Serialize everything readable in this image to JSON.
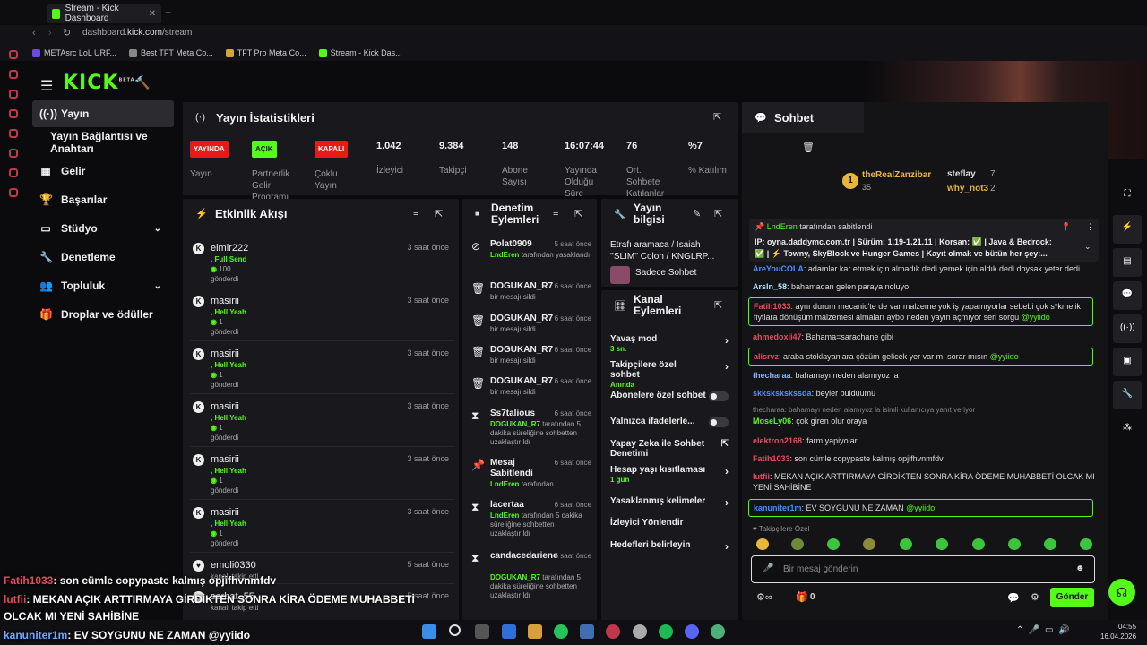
{
  "browser": {
    "tab_title": "Stream - Kick Dashboard",
    "url_prefix": "dashboard.",
    "url_domain": "kick.com",
    "url_path": "/stream",
    "bookmarks": [
      "METAsrc LoL URF...",
      "Best TFT Meta Co...",
      "TFT Pro Meta Co...",
      "Stream - Kick Das..."
    ]
  },
  "header": {
    "logo": "KICK",
    "logo_sup": "BETA"
  },
  "sidebar": {
    "items": [
      {
        "label": "Yayın",
        "icon": "broadcast-icon"
      },
      {
        "label": "Yayın Bağlantısı ve Anahtarı"
      },
      {
        "label": "Gelir",
        "icon": "revenue-icon"
      },
      {
        "label": "Başarılar",
        "icon": "trophy-icon"
      },
      {
        "label": "Stüdyo",
        "icon": "studio-icon"
      },
      {
        "label": "Denetleme",
        "icon": "wrench-icon"
      },
      {
        "label": "Topluluk",
        "icon": "community-icon"
      },
      {
        "label": "Droplar ve ödüller",
        "icon": "gift-icon"
      }
    ]
  },
  "stats": {
    "title": "Yayın İstatistikleri",
    "items": [
      {
        "value": "YAYINDA",
        "label": "Yayın",
        "badge_color": "#e91916"
      },
      {
        "value": "AÇIK",
        "label": "Partnerlik Gelir Programı",
        "badge_color": "#53fc18"
      },
      {
        "value": "KAPALI",
        "label": "Çoklu Yayın",
        "badge_color": "#e91916"
      },
      {
        "value": "1.042",
        "label": "İzleyici"
      },
      {
        "value": "9.384",
        "label": "Takipçi"
      },
      {
        "value": "148",
        "label": "Abone Sayısı"
      },
      {
        "value": "16:07:44",
        "label": "Yayında Olduğu Süre"
      },
      {
        "value": "76",
        "label": "Ort. Sohbete Katılanlar"
      },
      {
        "value": "%7",
        "label": "% Katılım"
      }
    ]
  },
  "activity": {
    "title": "Etkinlik Akışı",
    "items": [
      {
        "user": "elmir222",
        "time": "3 saat önce",
        "line1": ", Full Send",
        "amount": "100",
        "line3": "gönderdi"
      },
      {
        "user": "masirii",
        "time": "3 saat önce",
        "line1": ", Hell Yeah",
        "amount": "1",
        "line3": "gönderdi"
      },
      {
        "user": "masirii",
        "time": "3 saat önce",
        "line1": ", Hell Yeah",
        "amount": "1",
        "line3": "gönderdi"
      },
      {
        "user": "masirii",
        "time": "3 saat önce",
        "line1": ", Hell Yeah",
        "amount": "1",
        "line3": "gönderdi"
      },
      {
        "user": "masirii",
        "time": "3 saat önce",
        "line1": ", Hell Yeah",
        "amount": "1",
        "line3": "gönderdi"
      },
      {
        "user": "masirii",
        "time": "3 saat önce",
        "line1": ", Hell Yeah",
        "amount": "1",
        "line3": "gönderdi"
      },
      {
        "user": "emoli0330",
        "time": "5 saat önce",
        "line1": "kanalı takip etti",
        "amount": "",
        "line3": ""
      },
      {
        "user": "serbat_55",
        "time": "5 saat önce",
        "line1": "kanalı takip etti",
        "amount": "",
        "line3": ""
      }
    ]
  },
  "moderation": {
    "title": "Denetim Eylemleri",
    "items": [
      {
        "user": "Polat0909",
        "time": "5 saat önce",
        "by": "LndEren",
        "text": "tarafından yasaklandı"
      },
      {
        "user": "DOGUKAN_R7",
        "time": "6 saat önce",
        "by": "",
        "text": "bir mesajı sildi"
      },
      {
        "user": "DOGUKAN_R7",
        "time": "6 saat önce",
        "by": "",
        "text": "bir mesajı sildi"
      },
      {
        "user": "DOGUKAN_R7",
        "time": "6 saat önce",
        "by": "",
        "text": "bir mesajı sildi"
      },
      {
        "user": "DOGUKAN_R7",
        "time": "6 saat önce",
        "by": "",
        "text": "bir mesajı sildi"
      },
      {
        "user": "Ss7talious",
        "time": "6 saat önce",
        "by": "DOGUKAN_R7",
        "text": "tarafından 5 dakika süreliğine sohbetten uzaklaştırıldı"
      },
      {
        "user": "Mesaj Sabitlendi",
        "time": "6 saat önce",
        "by": "LndEren",
        "text": "tarafından"
      },
      {
        "user": "lacertaa",
        "time": "6 saat önce",
        "by": "LndEren",
        "text": "tarafından 5 dakika süreliğine sohbetten uzaklaştırıldı"
      },
      {
        "user": "candacedariene",
        "time": "6 saat önce",
        "by": "DOGUKAN_R7",
        "text": "tarafından 5 dakika süreliğine sohbetten uzaklaştırıldı"
      }
    ]
  },
  "stream_info": {
    "title": "Yayın bilgisi",
    "stream_title": "Etrafı aramaca / Isaiah ''SLIM'' Colon / KNGLRP...",
    "category": "Sadece Sohbet"
  },
  "channel_actions": {
    "title": "Kanal Eylemleri",
    "items": [
      {
        "label": "Yavaş mod",
        "sub": "3 sn.",
        "control": "arrow"
      },
      {
        "label": "Takipçilere özel sohbet",
        "sub": "Anında",
        "control": "arrow"
      },
      {
        "label": "Abonelere özel sohbet",
        "sub": "",
        "control": "toggle"
      },
      {
        "label": "Yalnızca ifadelerle...",
        "sub": "",
        "control": "toggle"
      },
      {
        "label": "Yapay Zeka ile Sohbet Denetimi",
        "sub": "",
        "control": "external"
      },
      {
        "label": "Hesap yaşı kısıtlaması",
        "sub": "1 gün",
        "control": "arrow"
      },
      {
        "label": "Yasaklanmış kelimeler",
        "sub": "",
        "control": "arrow"
      },
      {
        "label": "İzleyici Yönlendir",
        "sub": "",
        "control": ""
      },
      {
        "label": "Hedefleri belirleyin",
        "sub": "",
        "control": "arrow"
      }
    ]
  },
  "chat": {
    "title": "Sohbet",
    "leaderboard": [
      {
        "user": "theRealZanzibar",
        "score": "35",
        "rank": "1"
      },
      {
        "user": "steflay",
        "score": "7"
      },
      {
        "user": "why_not3",
        "score": "2"
      }
    ],
    "pinned_by": "LndEren",
    "pinned_suffix": "tarafından sabitlendi",
    "pinned_line1": "IP: oyna.daddymc.com.tr | Sürüm: 1.19-1.21.11 | Korsan: ✅ | Java & Bedrock:",
    "pinned_line2": "✅ | ⚡ Towny, SkyBlock ve Hunger Games | Kayıt olmak ve bütün her şey:...",
    "messages": [
      {
        "user": "AreYouCOLA",
        "color": "#4a90ff",
        "text": "adamlar kar etmek için almadık dedi yemek için aldık dedi doysak yeter dedi",
        "hl": false
      },
      {
        "user": "Arsln_58",
        "color": "#aee7ff",
        "text": "bahamadan gelen paraya noluyo",
        "hl": false
      },
      {
        "user": "Fatih1033",
        "color": "#e84a5f",
        "text": "aynı durum mecanic'te de var malzeme yok iş yapamıyorlar sebebi çok s*kmelik fiytlara dönüşüm malzemesi almaları aybo neden yayın açmıyor seri sorgu",
        "mention": "@yyiido",
        "hl": true
      },
      {
        "user": "ahmedoxii47",
        "color": "#e84a5f",
        "text": "Bahama=sarachane gibi",
        "hl": false
      },
      {
        "user": "alisrvz",
        "color": "#e84a5f",
        "text": "araba stoklayanlara çözüm gelicek yer var mı sorar mısın",
        "mention": "@yyiido",
        "hl": true
      },
      {
        "user": "thecharaa",
        "color": "#8ab4ff",
        "text": "bahamayı neden alamıyoz la",
        "hl": false
      },
      {
        "user": "skkskskskssda",
        "color": "#4a90ff",
        "text": "beyler bulduumu",
        "hl": false
      },
      {
        "user": "MoseLy06",
        "color": "#53fc18",
        "text": "çok giren olur oraya",
        "hl": false
      },
      {
        "user": "elektron2168",
        "color": "#e84a5f",
        "text": "farm yapiyolar",
        "hl": false
      },
      {
        "user": "Fatih1033",
        "color": "#e84a5f",
        "text": "son cümle copypaste kalmış opjifhvnmfdv",
        "hl": false
      },
      {
        "user": "lutfii",
        "color": "#e84a5f",
        "text": "MEKAN AÇIK ARTTIRMAYA GİRDİKTEN SONRA KİRA ÖDEME MUHABBETİ OLCAK MI YENİ SAHİBİNE",
        "hl": false
      },
      {
        "user": "kanuniter1m",
        "color": "#4a90ff",
        "text": "EV SOYGUNU NE ZAMAN",
        "mention": "@yyiido",
        "hl": true
      }
    ],
    "reply_note": "thecharaa: bahamayı neden alamıyoz la isimli kullanıcıya yanıt veriyor",
    "follower_only": "Takipçilere Özel",
    "input_placeholder": "Bir mesaj gönderin",
    "count": "0",
    "send_label": "Gönder"
  },
  "overlay": [
    {
      "user": "Fatih1033",
      "text": ": son cümle copypaste kalmış opjifhvnmfdv"
    },
    {
      "user": "lutfii",
      "text": ": MEKAN AÇIK ARTTIRMAYA GİRDİKTEN SONRA KİRA ÖDEME MUHABBETİ"
    },
    {
      "user": "",
      "text": "OLCAK MI YENİ SAHİBİNE"
    },
    {
      "user": "kanuniter1m",
      "text": ": EV SOYGUNU NE ZAMAN @yyiido"
    }
  ],
  "taskbar": {
    "time": "04:55",
    "date": "16.04.2026"
  },
  "colors": {
    "accent": "#53fc18",
    "panel": "#19191d",
    "live": "#e91916"
  }
}
